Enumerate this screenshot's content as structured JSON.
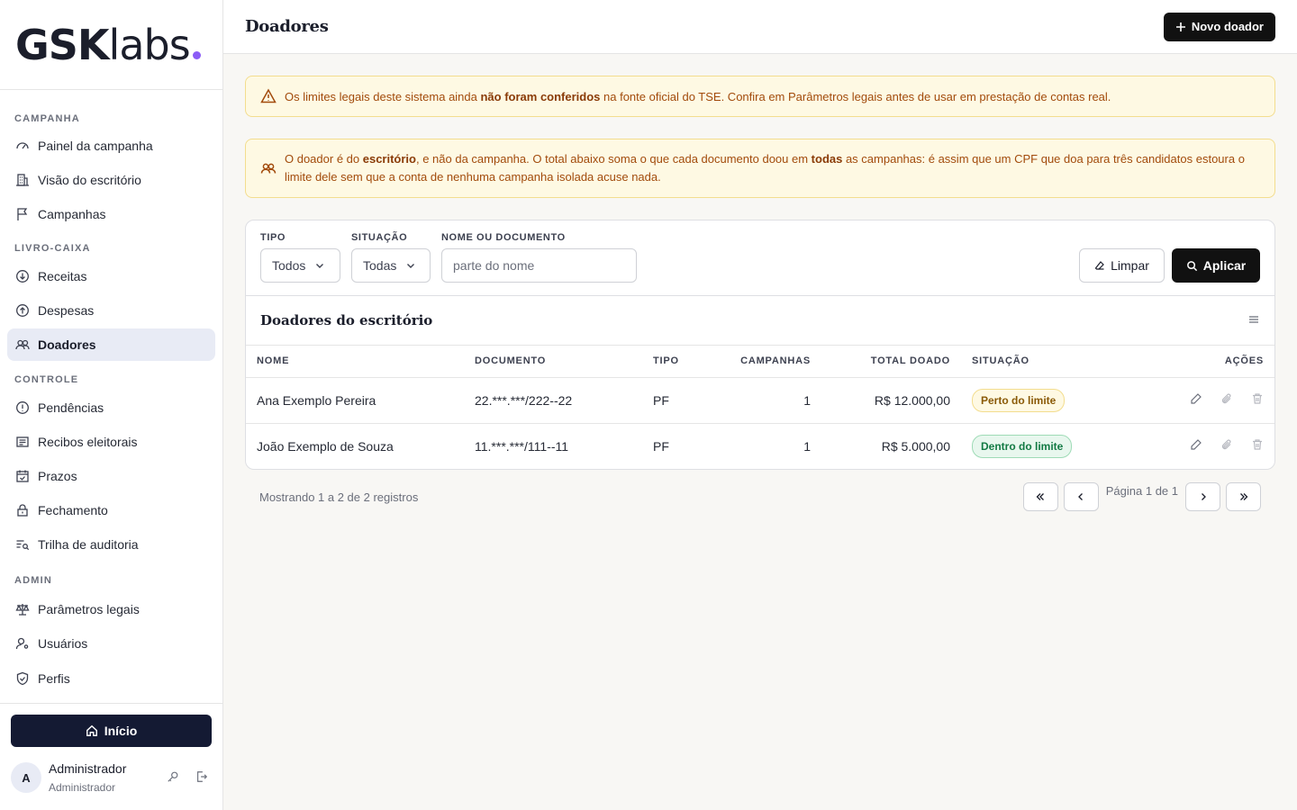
{
  "brand": {
    "bold": "GSK",
    "light": "labs",
    "dot_color": "#8b5cf6"
  },
  "sidebar": {
    "sections": [
      {
        "title": "CAMPANHA",
        "items": [
          {
            "label": "Painel da campanha",
            "icon": "gauge-icon"
          },
          {
            "label": "Visão do escritório",
            "icon": "building-icon"
          },
          {
            "label": "Campanhas",
            "icon": "flag-icon"
          }
        ]
      },
      {
        "title": "LIVRO-CAIXA",
        "items": [
          {
            "label": "Receitas",
            "icon": "arrow-down-circle-icon"
          },
          {
            "label": "Despesas",
            "icon": "arrow-up-circle-icon"
          },
          {
            "label": "Doadores",
            "icon": "users-icon",
            "active": true
          }
        ]
      },
      {
        "title": "CONTROLE",
        "items": [
          {
            "label": "Pendências",
            "icon": "alert-circle-icon"
          },
          {
            "label": "Recibos eleitorais",
            "icon": "receipt-icon"
          },
          {
            "label": "Prazos",
            "icon": "calendar-check-icon"
          },
          {
            "label": "Fechamento",
            "icon": "lock-icon"
          },
          {
            "label": "Trilha de auditoria",
            "icon": "list-search-icon"
          }
        ]
      },
      {
        "title": "ADMIN",
        "items": [
          {
            "label": "Parâmetros legais",
            "icon": "scale-icon"
          },
          {
            "label": "Usuários",
            "icon": "user-gear-icon"
          },
          {
            "label": "Perfis",
            "icon": "shield-icon"
          }
        ]
      }
    ],
    "home_label": "Início",
    "user": {
      "initial": "A",
      "name": "Administrador",
      "role": "Administrador"
    }
  },
  "header": {
    "title": "Doadores",
    "new_button": "Novo doador"
  },
  "alerts": {
    "legal": {
      "pre": "Os limites legais deste sistema ainda ",
      "bold": "não foram conferidos",
      "post": " na fonte oficial do TSE. Confira em Parâmetros legais antes de usar em prestação de contas real."
    },
    "office": {
      "p1": "O doador é do ",
      "b1": "escritório",
      "p2": ", e não da campanha. O total abaixo soma o que cada documento doou em ",
      "b2": "todas",
      "p3": " as campanhas: é assim que um CPF que doa para três candidatos estoura o limite dele sem que a conta de nenhuma campanha isolada acuse nada."
    }
  },
  "filters": {
    "tipo_label": "TIPO",
    "tipo_value": "Todos",
    "situacao_label": "SITUAÇÃO",
    "situacao_value": "Todas",
    "nome_label": "NOME OU DOCUMENTO",
    "nome_placeholder": "parte do nome",
    "clear_label": "Limpar",
    "apply_label": "Aplicar"
  },
  "table": {
    "title": "Doadores do escritório",
    "columns": [
      "NOME",
      "DOCUMENTO",
      "TIPO",
      "CAMPANHAS",
      "TOTAL DOADO",
      "SITUAÇÃO",
      "AÇÕES"
    ],
    "rows": [
      {
        "nome": "Ana Exemplo Pereira",
        "documento": "22.***.***/222--22",
        "tipo": "PF",
        "campanhas": "1",
        "total": "R$ 12.000,00",
        "situacao": "Perto do limite",
        "status": "warn"
      },
      {
        "nome": "João Exemplo de Souza",
        "documento": "11.***.***/111--11",
        "tipo": "PF",
        "campanhas": "1",
        "total": "R$ 5.000,00",
        "situacao": "Dentro do limite",
        "status": "ok"
      }
    ]
  },
  "pagination": {
    "summary": "Mostrando 1 a 2 de 2 registros",
    "page_label": "Página 1 de 1"
  }
}
